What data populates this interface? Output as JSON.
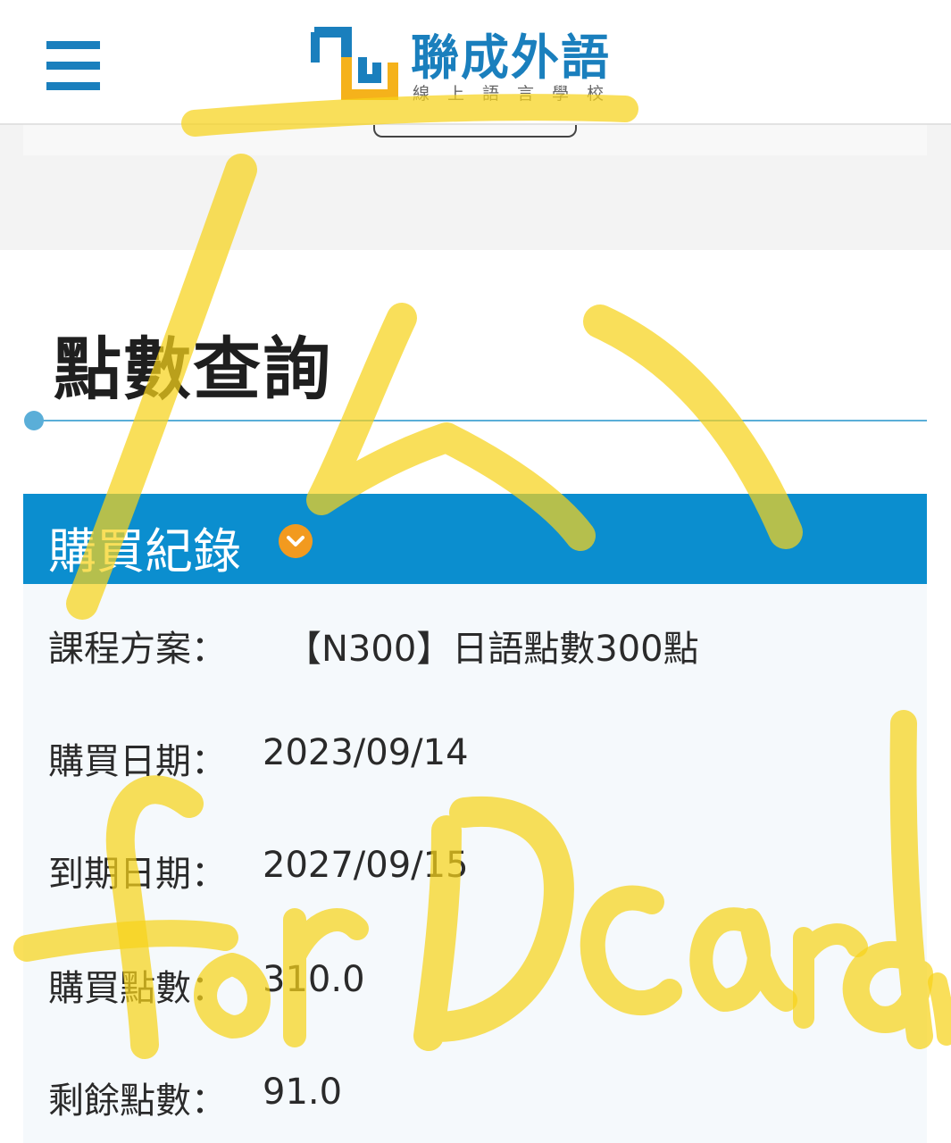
{
  "header": {
    "menu_icon": "hamburger-menu-icon",
    "logo_title": "聯成外語",
    "logo_subtitle": "線上語言學校"
  },
  "page_title": "點數查詢",
  "section": {
    "title": "購買紀錄",
    "toggle_icon": "chevron-down-icon"
  },
  "records": [
    {
      "label": "課程方案：",
      "value": "【N300】日語點數300點"
    },
    {
      "label": "購買日期：",
      "value": "2023/09/14"
    },
    {
      "label": "到期日期：",
      "value": "2027/09/15"
    },
    {
      "label": "購買點數：",
      "value": "310.0"
    },
    {
      "label": "剩餘點數：",
      "value": "91.0"
    }
  ],
  "colors": {
    "brand_blue": "#1a7fbd",
    "header_bar_blue": "#0b8ecf",
    "logo_yellow": "#f5b21b",
    "accent_orange": "#f29a1f",
    "highlighter_yellow": "#f7d21a"
  }
}
